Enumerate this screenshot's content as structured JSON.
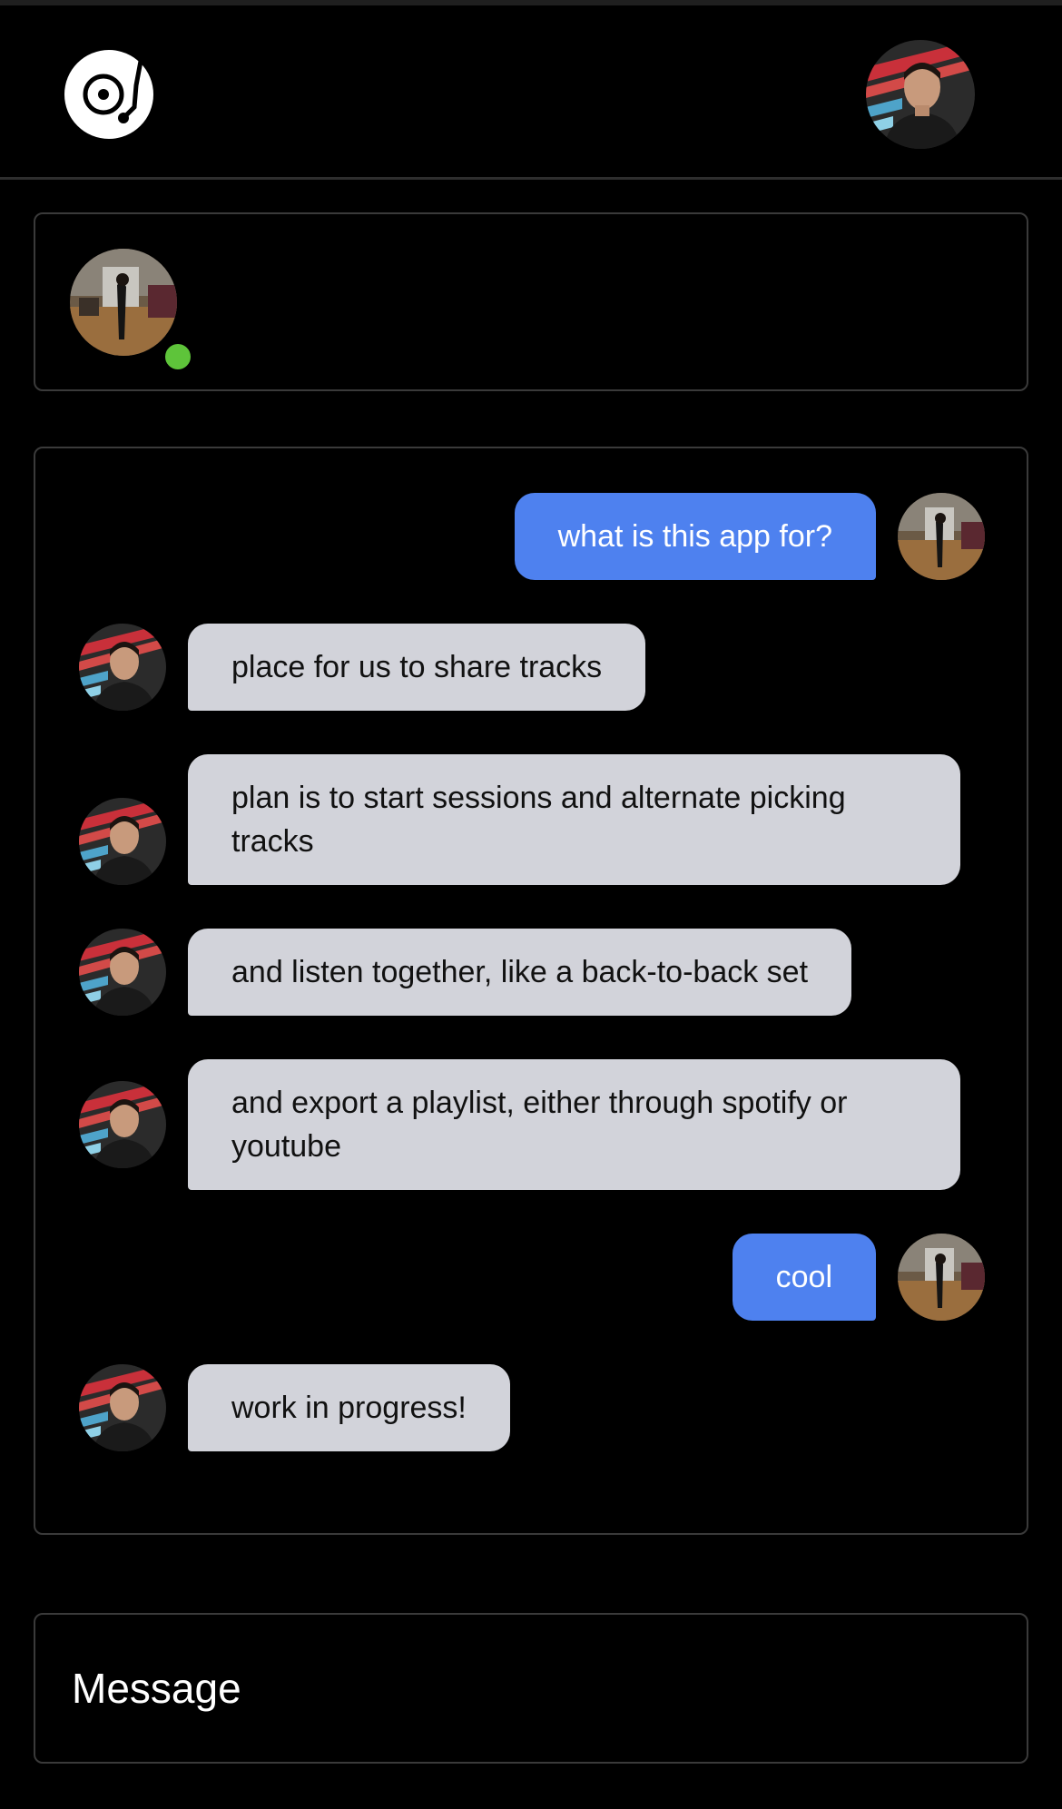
{
  "app": {
    "logo_icon": "turntable-record-icon"
  },
  "header": {
    "user_avatar": "profile-photo-man"
  },
  "presence": {
    "avatar": "profile-photo-room",
    "status": "online",
    "status_color": "#5ec43a"
  },
  "colors": {
    "outgoing_bubble": "#4e81ef",
    "incoming_bubble": "#d2d3da",
    "background": "#000000",
    "border": "#3a3a3a"
  },
  "messages": [
    {
      "direction": "outgoing",
      "text": "what is this app for?"
    },
    {
      "direction": "incoming",
      "text": "place for us to share tracks"
    },
    {
      "direction": "incoming",
      "text": "plan is to start sessions and alternate picking tracks"
    },
    {
      "direction": "incoming",
      "text": "and listen together, like a back-to-back set"
    },
    {
      "direction": "incoming",
      "text": "and export a playlist, either through spotify or youtube"
    },
    {
      "direction": "outgoing",
      "text": "cool"
    },
    {
      "direction": "incoming",
      "text": "work in progress!"
    }
  ],
  "composer": {
    "placeholder": "Message",
    "value": ""
  }
}
